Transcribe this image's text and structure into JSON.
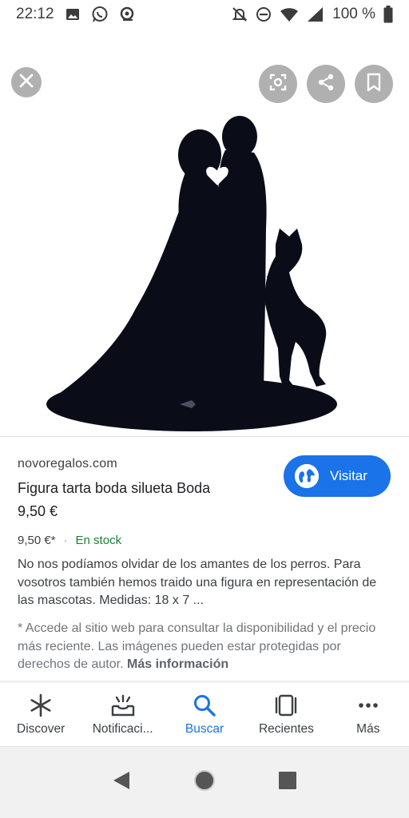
{
  "status_bar": {
    "time": "22:12",
    "battery": "100 %",
    "icons": [
      "image-icon",
      "whatsapp-icon",
      "assistant-icon",
      "mute-icon",
      "dnd-icon",
      "wifi-icon",
      "signal-icon",
      "battery-icon"
    ]
  },
  "image_viewer": {
    "buttons": [
      "close-icon",
      "lens-icon",
      "share-icon",
      "bookmark-icon"
    ]
  },
  "result": {
    "domain": "novoregalos.com",
    "title": "Figura tarta boda silueta Boda",
    "price": "9,50 €",
    "visit_label": "Visitar",
    "meta_price": "9,50 €*",
    "meta_separator": "·",
    "stock": "En stock",
    "description": "No nos podíamos olvidar de los amantes de los perros. Para vosotros también hemos traido una figura en representación de las mascotas. Medidas: 18 x 7 ...",
    "note": "* Accede al sitio web para consultar la disponibilidad y el precio más reciente. Las imágenes pueden estar protegidas por derechos de autor.",
    "more_info": "Más información"
  },
  "bottom_nav": {
    "items": [
      {
        "label": "Discover",
        "icon": "asterisk-icon"
      },
      {
        "label": "Notificaci...",
        "icon": "notifications-icon"
      },
      {
        "label": "Buscar",
        "icon": "search-icon"
      },
      {
        "label": "Recientes",
        "icon": "recents-icon"
      },
      {
        "label": "Más",
        "icon": "more-icon"
      }
    ],
    "active_index": 2
  },
  "colors": {
    "accent": "#1a73e8",
    "stock": "#188038"
  }
}
